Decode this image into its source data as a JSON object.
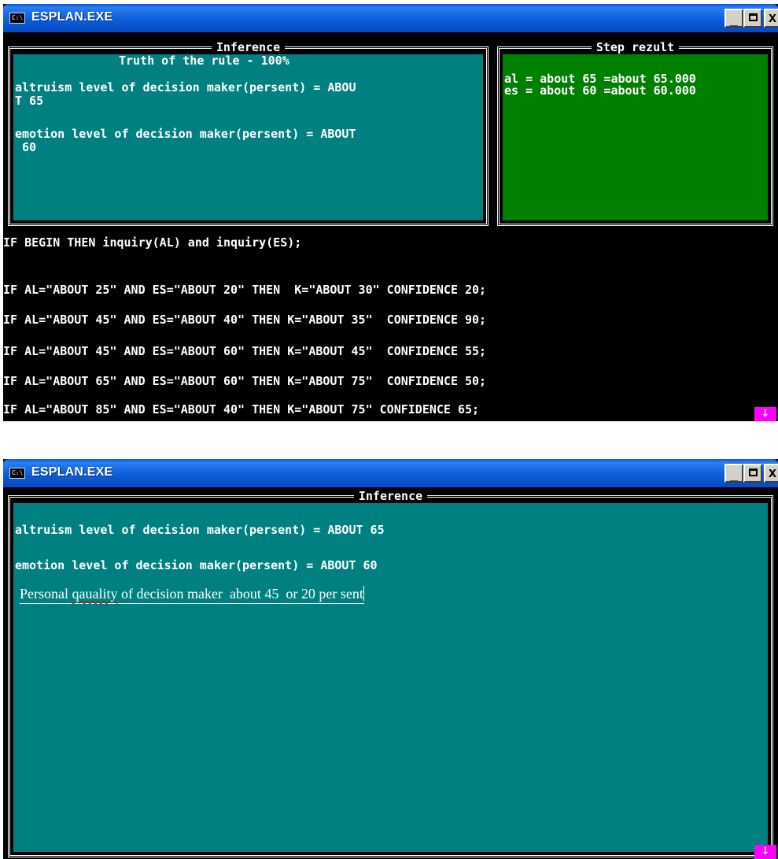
{
  "window1": {
    "title": "ESPLAN.EXE",
    "inference": {
      "title": "Inference",
      "truth_line": "Truth of the rule - 100%",
      "lines": [
        "altruism level of decision maker(persent) = ABOU",
        "T 65",
        "",
        "emotion level of decision maker(persent) = ABOUT",
        " 60"
      ]
    },
    "step_result": {
      "title": "Step rezult",
      "lines": [
        "al = about 65 =about 65.000",
        "es = about 60 =about 60.000"
      ]
    },
    "rules": [
      "IF BEGIN THEN inquiry(AL) and inquiry(ES);",
      "IF AL=\"ABOUT 25\" AND ES=\"ABOUT 20\" THEN  K=\"ABOUT 30\" CONFIDENCE 20;",
      "IF AL=\"ABOUT 45\" AND ES=\"ABOUT 40\" THEN K=\"ABOUT 35\"  CONFIDENCE 90;",
      "IF AL=\"ABOUT 45\" AND ES=\"ABOUT 60\" THEN K=\"ABOUT 45\"  CONFIDENCE 55;",
      "IF AL=\"ABOUT 65\" AND ES=\"ABOUT 60\" THEN K=\"ABOUT 75\"  CONFIDENCE 50;",
      "IF AL=\"ABOUT 85\" AND ES=\"ABOUT 40\" THEN K=\"ABOUT 75\" CONFIDENCE 65;"
    ],
    "scroll_arrow": "↓"
  },
  "window2": {
    "title": "ESPLAN.EXE",
    "inference": {
      "title": "Inference",
      "lines": [
        "altruism level of decision maker(persent) = ABOUT 65",
        "emotion level of decision maker(persent) = ABOUT 60"
      ],
      "input": {
        "before": "Personal ",
        "misspelled": "qauality",
        "after": " of decision maker  about 45  or 20 per sent"
      }
    },
    "scroll_arrow": "↓"
  },
  "title_icon_text": "C:\\",
  "buttons": {
    "minimize": "_",
    "close": "x"
  },
  "colors": {
    "title_bar": "#0a5ce0",
    "inference_bg": "#008080",
    "step_result_bg": "#008000",
    "console_bg": "#000000",
    "scroll_marker": "#ff00ff"
  }
}
